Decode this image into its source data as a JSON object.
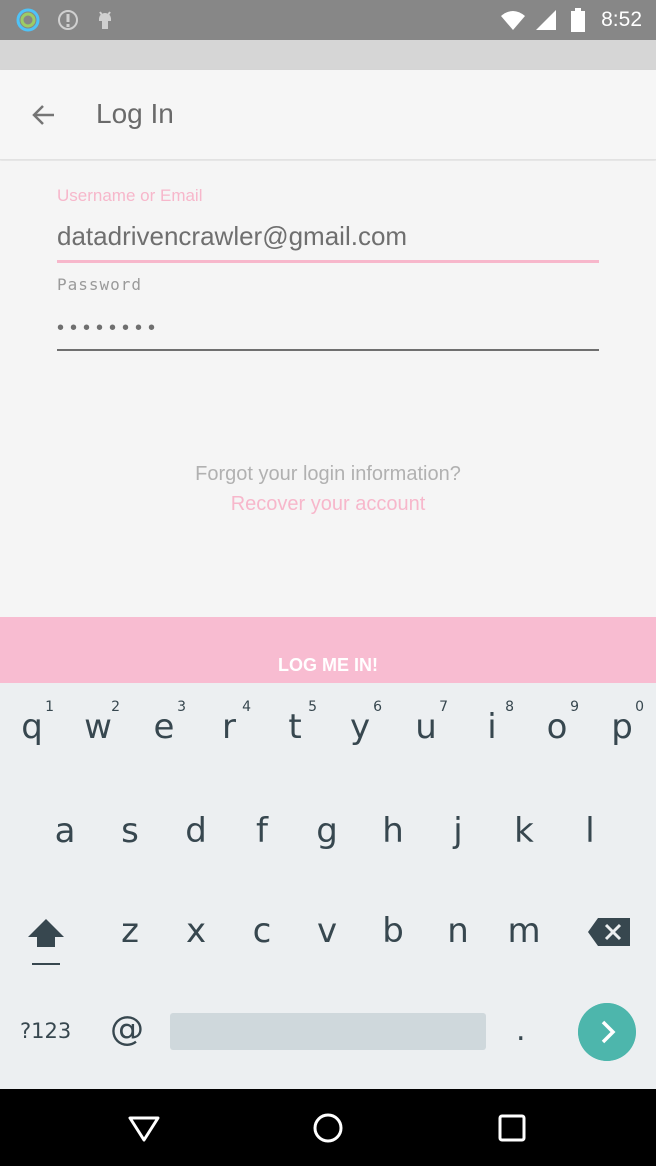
{
  "status_bar": {
    "time": "8:52",
    "icons": [
      "circle-app-icon",
      "alert-icon",
      "android-debug-icon",
      "wifi-icon",
      "signal-icon",
      "battery-icon"
    ]
  },
  "app_bar": {
    "back_icon": "arrow-left-icon",
    "title": "Log In"
  },
  "form": {
    "username_label": "Username or Email",
    "username_value": "datadrivencrawler@gmail.com",
    "password_label": "Password",
    "password_value": "••••••••",
    "forgot_text": "Forgot your login information?",
    "recover_link": "Recover your account",
    "submit_label": "LOG ME IN!"
  },
  "keyboard": {
    "row1": [
      {
        "ch": "q",
        "num": "1"
      },
      {
        "ch": "w",
        "num": "2"
      },
      {
        "ch": "e",
        "num": "3"
      },
      {
        "ch": "r",
        "num": "4"
      },
      {
        "ch": "t",
        "num": "5"
      },
      {
        "ch": "y",
        "num": "6"
      },
      {
        "ch": "u",
        "num": "7"
      },
      {
        "ch": "i",
        "num": "8"
      },
      {
        "ch": "o",
        "num": "9"
      },
      {
        "ch": "p",
        "num": "0"
      }
    ],
    "row2": [
      "a",
      "s",
      "d",
      "f",
      "g",
      "h",
      "j",
      "k",
      "l"
    ],
    "row3": [
      "z",
      "x",
      "c",
      "v",
      "b",
      "n",
      "m"
    ],
    "symbols_key": "?123",
    "at_key": "@",
    "period_key": ".",
    "shift_icon": "shift-arrow-icon",
    "backspace_icon": "backspace-icon",
    "go_icon": "chevron-right-icon"
  },
  "nav_bar": {
    "icons": [
      "back-triangle-icon",
      "home-circle-icon",
      "recents-square-icon"
    ]
  },
  "colors": {
    "accent_pink": "#f7b7cb",
    "button_pink": "#f8bcd1",
    "keyboard_teal": "#4db6ac"
  }
}
